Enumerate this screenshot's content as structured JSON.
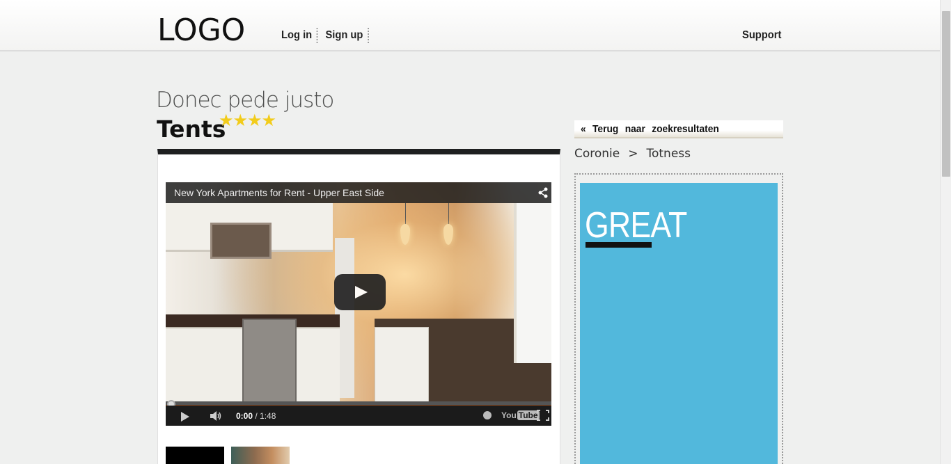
{
  "header": {
    "logo": "LOGO",
    "nav": [
      {
        "label": "Log in"
      },
      {
        "label": "Sign up"
      }
    ],
    "support": "Support"
  },
  "listing": {
    "subtitle": "Donec pede justo",
    "title": "Tents",
    "rating_stars": 4,
    "stars_text": "★★★★"
  },
  "video": {
    "title": "New York Apartments for Rent - Upper East Side",
    "current_time": "0:00",
    "duration": "1:48",
    "progress": 0,
    "brand_prefix": "You",
    "brand_suffix": "Tube"
  },
  "sidebar": {
    "back_link": "«  Terug  naar  zoekresultaten",
    "breadcrumb": [
      "Coronie",
      "Totness"
    ],
    "breadcrumb_separator": ">",
    "ad_text": "GREAT",
    "ad_color": "#52b8dc"
  },
  "colors": {
    "background": "#eff0ef",
    "star": "#f2cc1b",
    "panel_border": "#1e1f20"
  }
}
